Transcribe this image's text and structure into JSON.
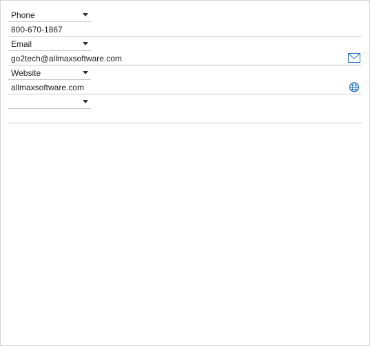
{
  "contacts": [
    {
      "type": "Phone",
      "value": "800-670-1867",
      "icon": ""
    },
    {
      "type": "Email",
      "value": "go2tech@allmaxsoftware.com",
      "icon": "mail-icon"
    },
    {
      "type": "Website",
      "value": "allmaxsoftware.com",
      "icon": "globe-icon"
    },
    {
      "type": "",
      "value": "",
      "icon": ""
    }
  ],
  "colors": {
    "icon_accent": "#1f6fb5",
    "divider": "#c6c6c6"
  }
}
